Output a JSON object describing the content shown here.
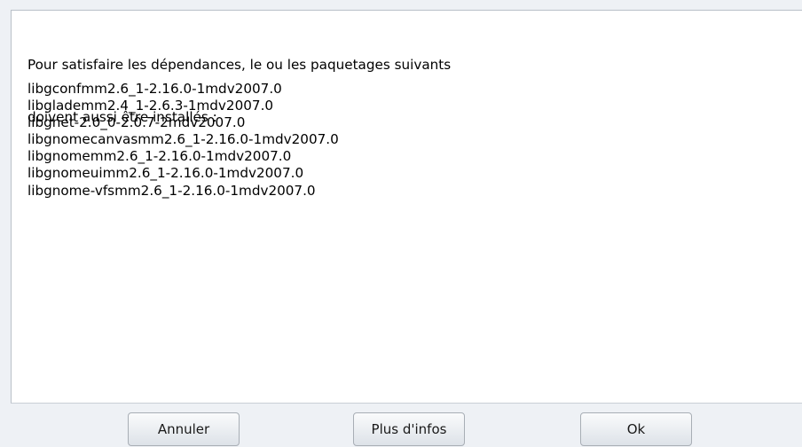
{
  "dialog": {
    "message_line_1": "Pour satisfaire les dépendances, le ou les paquetages suivants",
    "message_line_2": "doivent aussi être installés :",
    "packages": [
      "libgconfmm2.6_1-2.16.0-1mdv2007.0",
      "libglademm2.4_1-2.6.3-1mdv2007.0",
      "libgnet-2.0_0-2.0.7-2mdv2007.0",
      "libgnomecanvasmm2.6_1-2.16.0-1mdv2007.0",
      "libgnomemm2.6_1-2.16.0-1mdv2007.0",
      "libgnomeuimm2.6_1-2.16.0-1mdv2007.0",
      "libgnome-vfsmm2.6_1-2.16.0-1mdv2007.0"
    ]
  },
  "buttons": {
    "cancel_label": "Annuler",
    "info_label": "Plus d'infos",
    "ok_label": "Ok"
  }
}
